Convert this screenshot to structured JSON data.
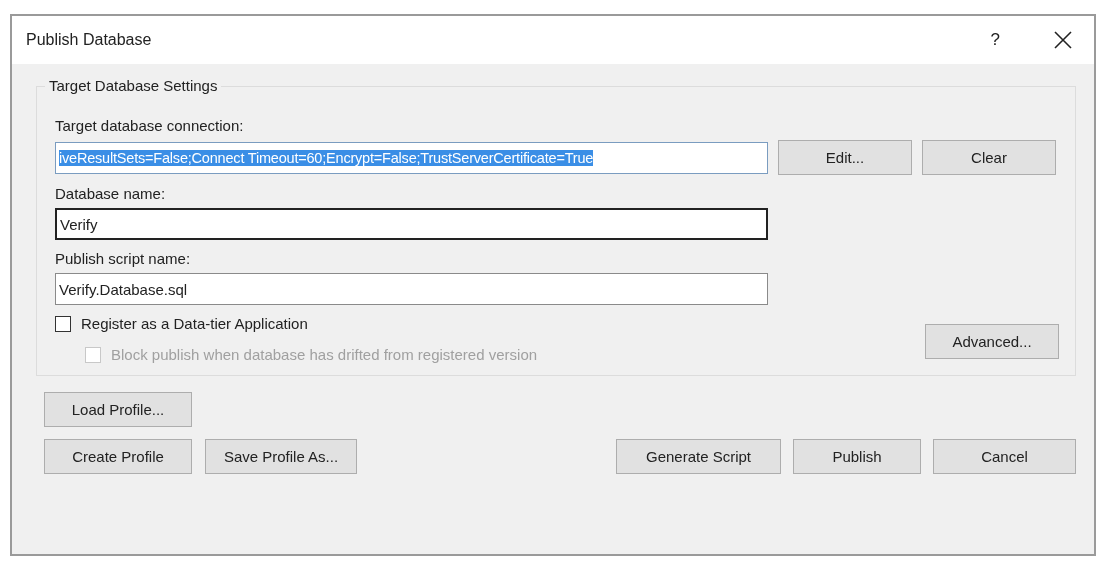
{
  "window": {
    "title": "Publish Database",
    "help": "?"
  },
  "group": {
    "title": "Target Database Settings"
  },
  "connection": {
    "label": "Target database connection:",
    "value": "iveResultSets=False;Connect Timeout=60;Encrypt=False;TrustServerCertificate=True",
    "text_selected": true,
    "buttons": [
      "Edit...",
      "Clear"
    ]
  },
  "fields": [
    {
      "label": "Database name:",
      "value": "Verify",
      "focused": true
    },
    {
      "label": "Publish script name:",
      "value": "Verify.Database.sql",
      "focused": false
    }
  ],
  "checkboxes": [
    {
      "label": "Register as a Data-tier Application",
      "checked": false,
      "disabled": false
    },
    {
      "label": "Block publish when database has drifted from registered version",
      "checked": false,
      "disabled": true
    }
  ],
  "advanced_button": "Advanced...",
  "profile_buttons": [
    "Load Profile...",
    "Create Profile",
    "Save Profile As..."
  ],
  "action_buttons": [
    "Generate Script",
    "Publish",
    "Cancel"
  ]
}
